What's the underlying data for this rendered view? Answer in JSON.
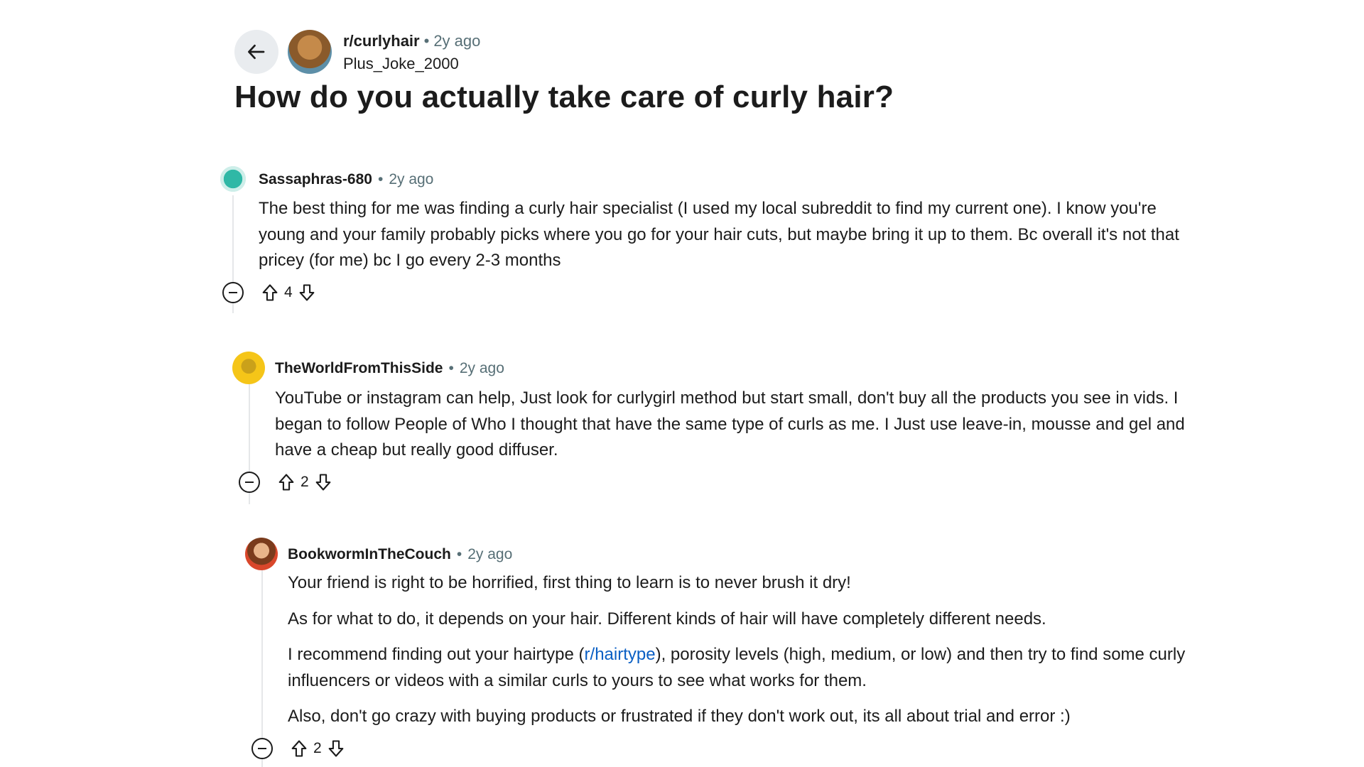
{
  "post": {
    "subreddit": "r/curlyhair",
    "age": "2y ago",
    "author": "Plus_Joke_2000",
    "title": "How do you actually take care of curly hair?"
  },
  "separator": "•",
  "comments": [
    {
      "author": "Sassaphras-680",
      "age": "2y ago",
      "text": "The best thing for me was finding a curly hair specialist (I used my local subreddit to find my current one). I know you're young and your family probably picks where you go for your hair cuts, but maybe bring it up to them. Bc overall it's not that pricey (for me) bc I go every 2-3 months",
      "score": "4"
    },
    {
      "author": "TheWorldFromThisSide",
      "age": "2y ago",
      "text": "YouTube or instagram can help, Just look for curlygirl method but start small, don't buy all the products you see in vids. I began to follow People of Who I thought that have the same type of curls as me. I Just use leave-in, mousse and gel and have a cheap but really good diffuser.",
      "score": "2"
    },
    {
      "author": "BookwormInTheCouch",
      "age": "2y ago",
      "p1": "Your friend is right to be horrified, first thing to learn is to never brush it dry!",
      "p2": "As for what to do, it depends on your hair. Different kinds of hair will have completely different needs.",
      "p3_before": "I recommend finding out your hairtype (",
      "p3_link": "r/hairtype",
      "p3_after": "), porosity levels (high, medium, or low) and then try to find some curly influencers or videos with a similar curls to yours to see what works for them.",
      "p4": "Also, don't go crazy with buying products or frustrated if they don't work out, its all about trial and error :)",
      "score": "2"
    }
  ],
  "icons": {
    "back": "arrow-left-icon",
    "collapse": "collapse-circle-minus-icon",
    "upvote": "upvote-arrow-icon",
    "downvote": "downvote-arrow-icon"
  },
  "colors": {
    "link": "#0a5fc4",
    "meta": "#576f76",
    "button_bg": "#e9ecef"
  }
}
